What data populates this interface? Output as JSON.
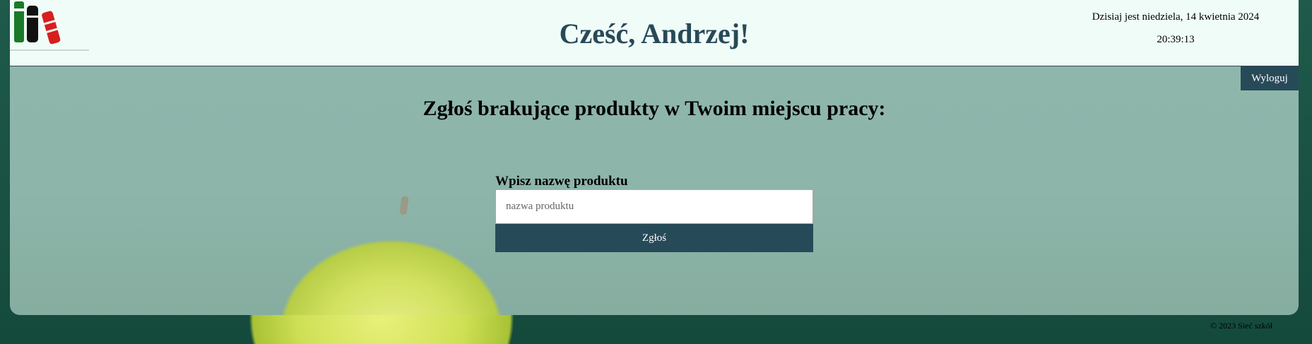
{
  "header": {
    "greeting": "Cześć, Andrzej!",
    "date_text": "Dzisiaj jest niedziela, 14 kwietnia 2024",
    "time_text": "20:39:13",
    "logo_icon": "books-logo-icon"
  },
  "nav": {
    "logout_label": "Wyloguj"
  },
  "main": {
    "heading": "Zgłoś brakujące produkty w Twoim miejscu pracy:",
    "form": {
      "label": "Wpisz nazwę produktu",
      "input_value": "",
      "input_placeholder": "nazwa produktu",
      "submit_label": "Zgłoś"
    }
  },
  "footer": {
    "text": "© 2023 Sieć szkół"
  },
  "colors": {
    "accent": "#274a58",
    "header_bg": "#f0fcf7",
    "logo_green": "#1a7a28",
    "logo_red": "#d81e1e"
  }
}
